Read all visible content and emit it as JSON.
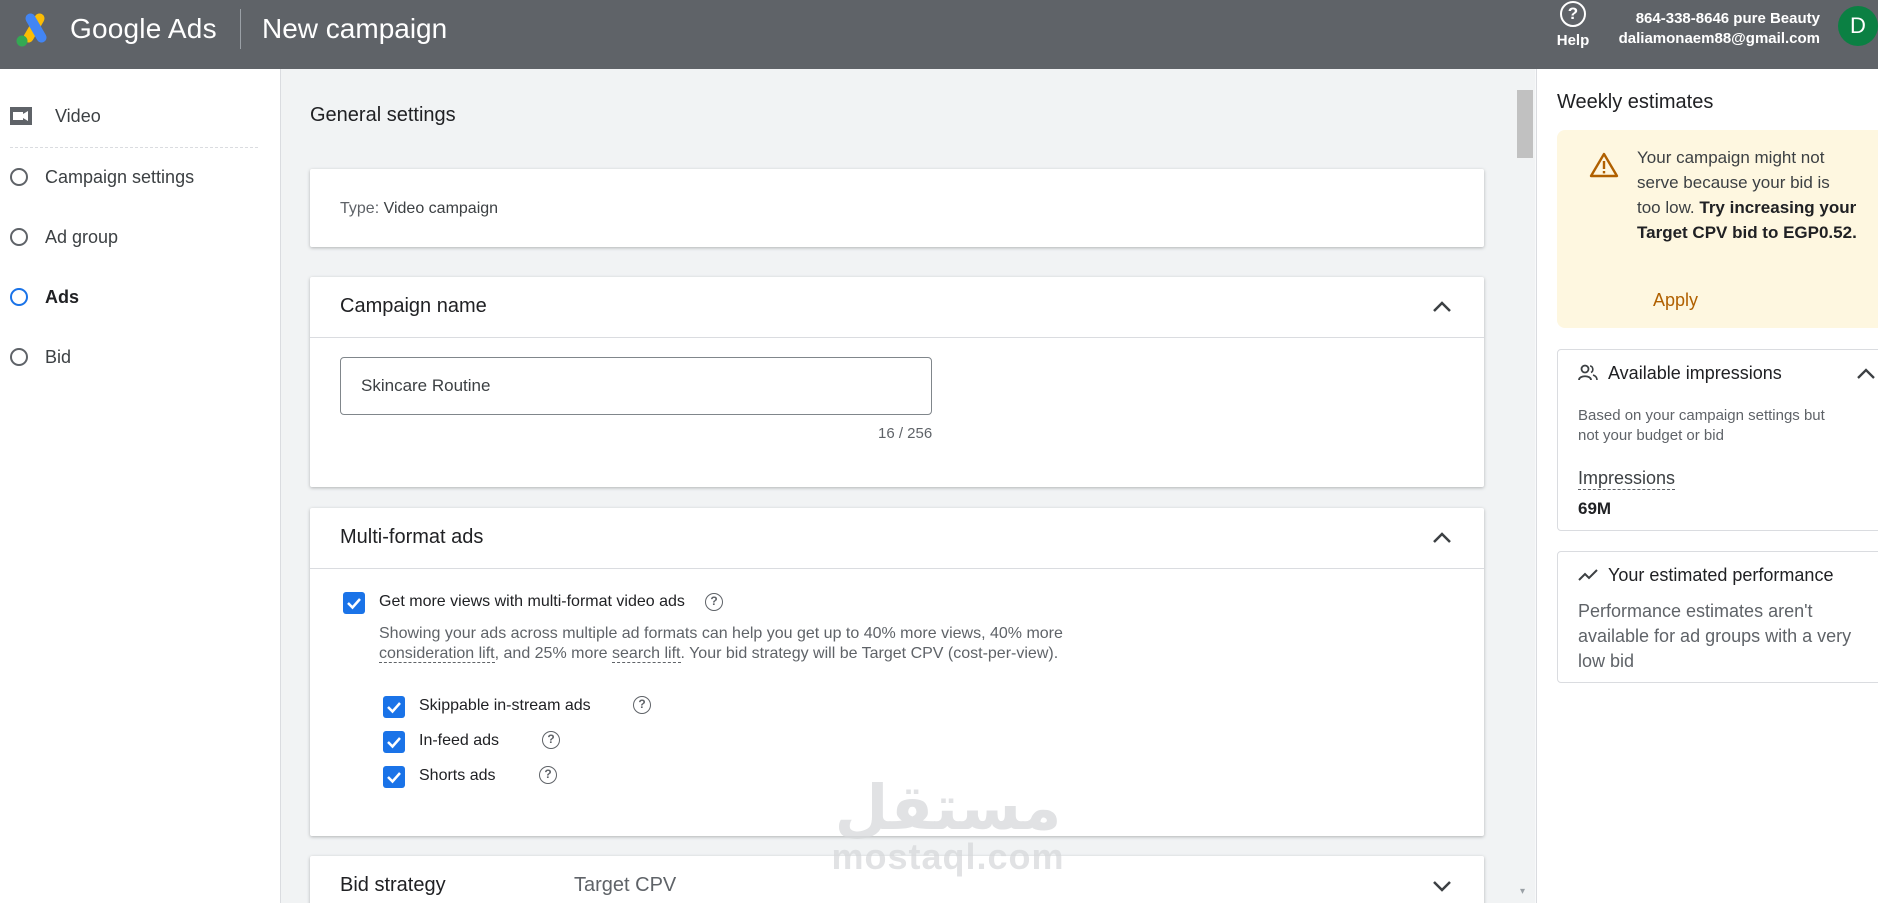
{
  "header": {
    "brand": "Google Ads",
    "page_title": "New campaign",
    "help_label": "Help",
    "help_icon_glyph": "?",
    "account_line1": "864-338-8646 pure Beauty",
    "account_line2": "daliamonaem88@gmail.com",
    "avatar_initial": "D",
    "bg_color": "#5f6368",
    "avatar_color": "#0b8043"
  },
  "sidebar": {
    "items": [
      {
        "label": "Video",
        "icon": "video-camera-icon"
      },
      {
        "label": "Campaign settings",
        "icon": "radio-icon"
      },
      {
        "label": "Ad group",
        "icon": "radio-icon"
      },
      {
        "label": "Ads",
        "icon": "radio-icon",
        "active": true
      },
      {
        "label": "Bid",
        "icon": "radio-icon"
      }
    ]
  },
  "main": {
    "section_title": "General settings",
    "type_label": "Type:",
    "type_value": "Video campaign",
    "campaign_name": {
      "title": "Campaign name",
      "value": "Skincare Routine",
      "counter": "16 / 256"
    },
    "multi_format": {
      "title": "Multi-format ads",
      "main_checkbox_label": "Get more views with multi-format video ads",
      "desc_part1": "Showing your ads across multiple ad formats can help you get up to 40% more views, 40% more ",
      "desc_link1": "consideration lift",
      "desc_part2": ", and 25% more ",
      "desc_link2": "search lift",
      "desc_part3": ". Your bid strategy will be Target CPV (cost-per-view).",
      "options": [
        {
          "label": "Skippable in-stream ads",
          "checked": true
        },
        {
          "label": "In-feed ads",
          "checked": true
        },
        {
          "label": "Shorts ads",
          "checked": true
        }
      ]
    },
    "bid_strategy": {
      "title": "Bid strategy",
      "value": "Target CPV"
    }
  },
  "right_panel": {
    "title": "Weekly estimates",
    "warning_text": "Your campaign might not serve because your bid is too low. ",
    "warning_bold": "Try increasing your Target CPV bid to EGP0.52.",
    "apply_label": "Apply",
    "warning_bg": "#fef7e0",
    "impressions": {
      "title": "Available impressions",
      "subtitle": "Based on your campaign settings but not your budget or bid",
      "label": "Impressions",
      "value": "69M"
    },
    "performance": {
      "title": "Your estimated performance",
      "text": "Performance estimates aren't available for ad groups with a very low bid"
    }
  },
  "watermark": {
    "arabic": "مستقل",
    "latin": "mostaql.com"
  },
  "accent_color": "#1a73e8"
}
